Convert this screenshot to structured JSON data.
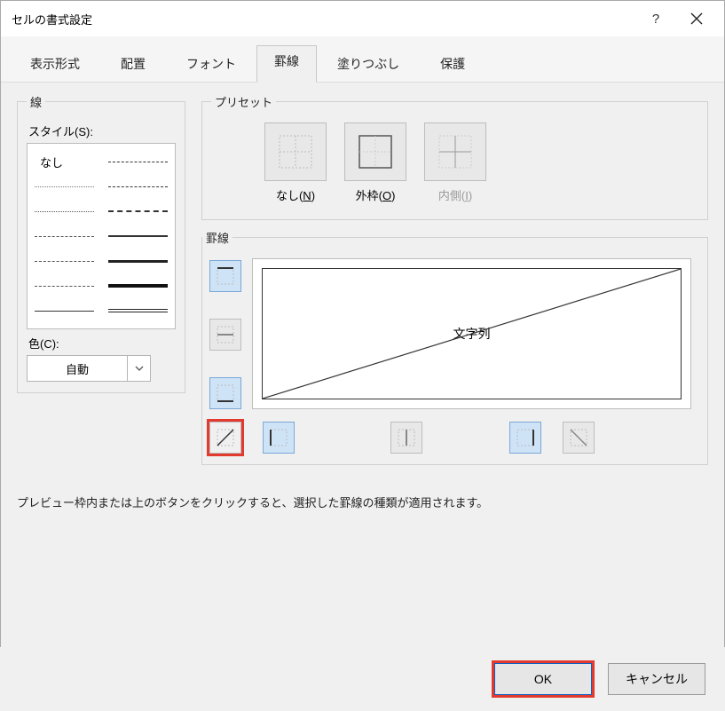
{
  "title": "セルの書式設定",
  "tabs": [
    "表示形式",
    "配置",
    "フォント",
    "罫線",
    "塗りつぶし",
    "保護"
  ],
  "active_tab_index": 3,
  "line_group": {
    "legend": "線",
    "style_label": "スタイル(S):",
    "none_label": "なし",
    "color_label": "色(C):",
    "color_value": "自動"
  },
  "preset_group": {
    "legend": "プリセット",
    "items": [
      {
        "label": "なし(N)",
        "underline_char": "N",
        "disabled": false
      },
      {
        "label": "外枠(O)",
        "underline_char": "O",
        "disabled": false
      },
      {
        "label": "内側(I)",
        "underline_char": "I",
        "disabled": true
      }
    ]
  },
  "border_group": {
    "legend": "罫線",
    "preview_text": "文字列"
  },
  "help_text": "プレビュー枠内または上のボタンをクリックすると、選択した罫線の種類が適用されます。",
  "footer": {
    "ok": "OK",
    "cancel": "キャンセル"
  },
  "chart_data": null
}
